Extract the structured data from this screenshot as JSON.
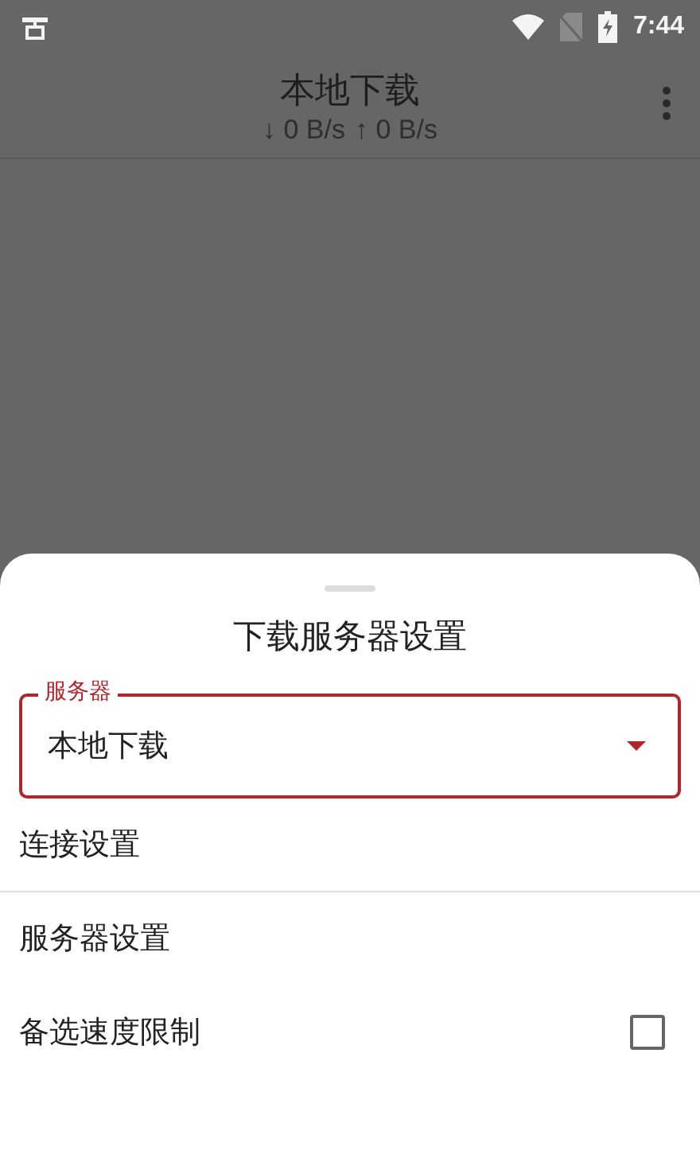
{
  "status_bar": {
    "time": "7:44"
  },
  "app_bar": {
    "title": "本地下载",
    "speed_down": "↓ 0 B/s",
    "speed_up": "↑ 0 B/s"
  },
  "sheet": {
    "title": "下载服务器设置",
    "server_field": {
      "label": "服务器",
      "value": "本地下载"
    },
    "items": [
      {
        "kind": "link",
        "label": "连接设置"
      },
      {
        "kind": "divider"
      },
      {
        "kind": "link",
        "label": "服务器设置"
      },
      {
        "kind": "checkbox",
        "label": "备选速度限制",
        "checked": false
      }
    ]
  }
}
